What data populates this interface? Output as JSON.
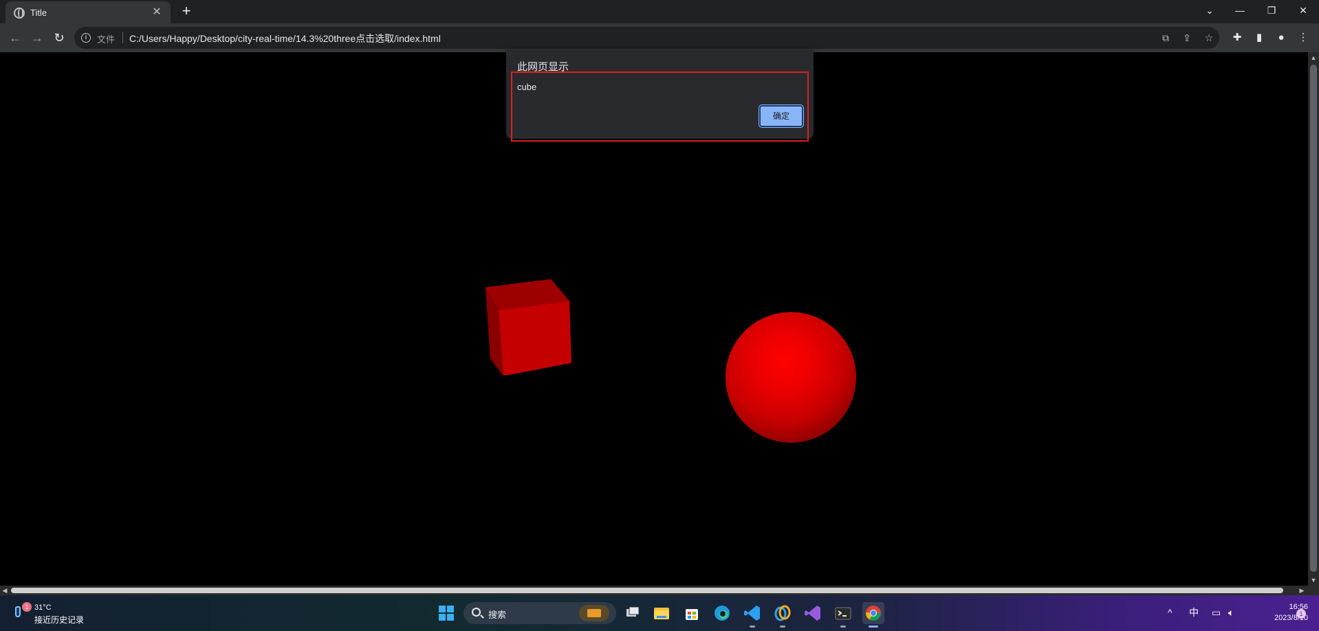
{
  "browser": {
    "tab_title": "Title",
    "tab_close": "✕",
    "new_tab": "+",
    "window_controls": [
      "⌄",
      "—",
      "❐",
      "✕"
    ],
    "nav": {
      "back": "←",
      "forward": "→",
      "reload": "↻"
    },
    "file_label": "文件",
    "url": "C:/Users/Happy/Desktop/city-real-time/14.3%20three点击选取/index.html",
    "icons": [
      "translate-icon",
      "share-icon",
      "star-icon",
      "extensions-icon",
      "sidepanel-icon",
      "profile-icon",
      "menu-icon"
    ]
  },
  "dialog": {
    "title": "此网页显示",
    "message": "cube",
    "ok_label": "确定"
  },
  "scene": {
    "objects": [
      "cube",
      "sphere"
    ],
    "color": "#ff0000"
  },
  "taskbar": {
    "weather_temp": "31°C",
    "weather_desc": "接近历史记录",
    "weather_badge": "1",
    "search_label": "搜索",
    "apps": [
      "task-view-icon",
      "file-explorer-icon",
      "store-icon",
      "edge-icon",
      "vscode-icon",
      "app-icon",
      "visual-studio-icon",
      "terminal-icon",
      "chrome-icon"
    ],
    "tray_ime": "中",
    "time": "16:56",
    "date": "2023/8/10",
    "notification_count": "1"
  }
}
